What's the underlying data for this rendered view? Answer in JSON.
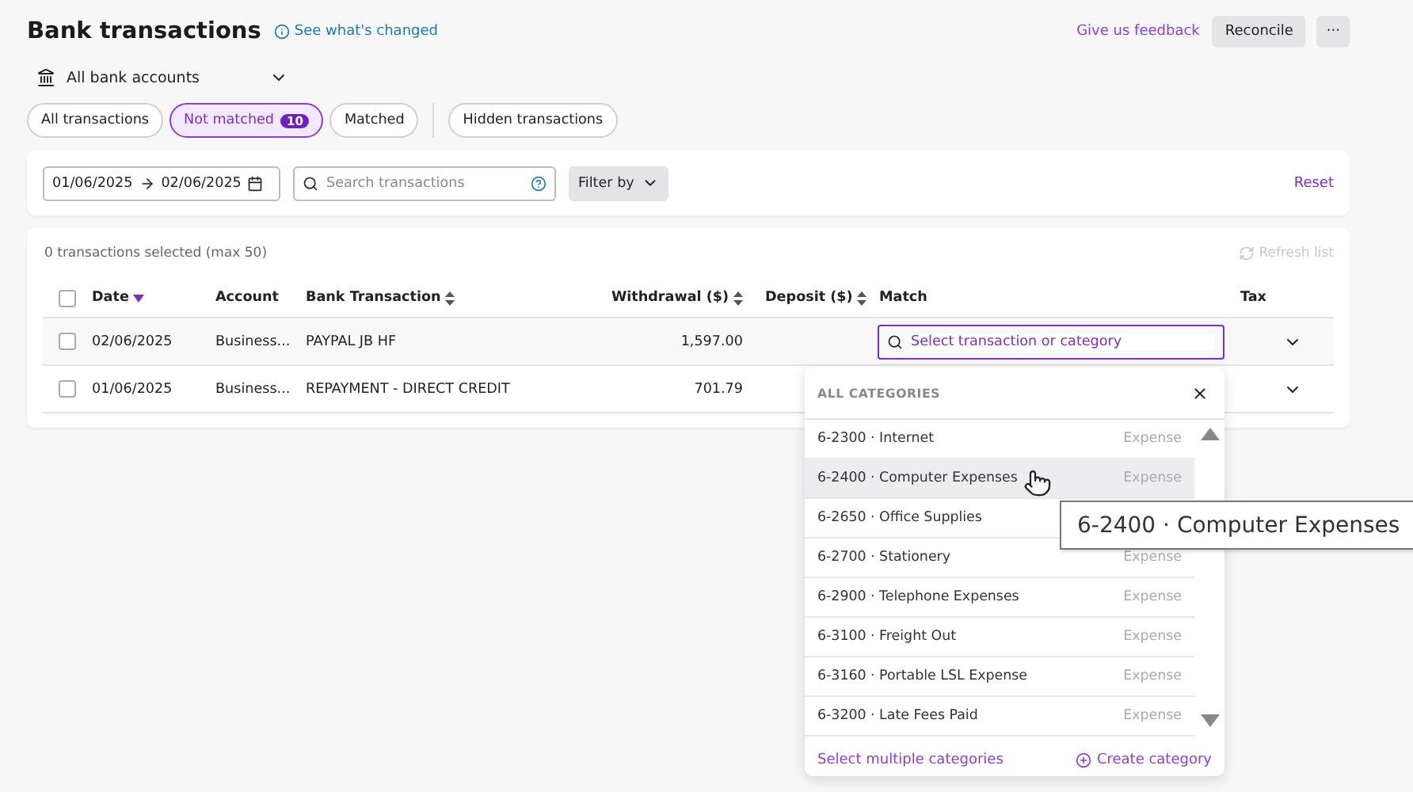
{
  "header": {
    "title": "Bank transactions",
    "whats_changed": "See what's changed",
    "feedback": "Give us feedback",
    "reconcile": "Reconcile",
    "more": "···"
  },
  "account_selector": {
    "value": "All bank accounts"
  },
  "tabs": [
    {
      "label": "All transactions",
      "selected": false
    },
    {
      "label": "Not matched",
      "selected": true,
      "count": "10"
    },
    {
      "label": "Matched",
      "selected": false
    },
    {
      "label": "Hidden transactions",
      "selected": false
    }
  ],
  "filters": {
    "date_from": "01/06/2025",
    "date_to": "02/06/2025",
    "search": {
      "placeholder": "Search transactions"
    },
    "filter_by": "Filter by",
    "reset": "Reset"
  },
  "table": {
    "selection_note": "0 transactions selected (max 50)",
    "refresh": "Refresh list",
    "select_all_checked": false,
    "columns": [
      {
        "label": "Date",
        "sortable": true,
        "sorted": true
      },
      {
        "label": "Account",
        "sortable": false,
        "sorted": false
      },
      {
        "label": "Bank Transaction",
        "sortable": true,
        "sorted": false
      },
      {
        "label": "Withdrawal ($)",
        "sortable": true,
        "sorted": false
      },
      {
        "label": "Deposit ($)",
        "sortable": true,
        "sorted": false
      },
      {
        "label": "Match",
        "sortable": false,
        "sorted": false
      },
      {
        "label": "Tax",
        "sortable": false,
        "sorted": false
      }
    ],
    "rows": [
      {
        "checked": false,
        "date": "02/06/2025",
        "account": "Business...",
        "transaction": "PAYPAL JB HF",
        "withdrawal": "1,597.00",
        "match_placeholder": "Select transaction or category"
      },
      {
        "checked": false,
        "date": "01/06/2025",
        "account": "Business...",
        "transaction": "REPAYMENT - DIRECT CREDIT",
        "withdrawal": "701.79"
      }
    ]
  },
  "category_dropdown": {
    "heading": "ALL CATEGORIES",
    "items": [
      {
        "label": "6-2300 · Internet",
        "type": "Expense",
        "hovered": false
      },
      {
        "label": "6-2400 · Computer Expenses",
        "type": "Expense",
        "hovered": true
      },
      {
        "label": "6-2650 · Office Supplies",
        "hovered": false
      },
      {
        "label": "6-2700 · Stationery",
        "type": "Expense",
        "hovered": false
      },
      {
        "label": "6-2900 · Telephone Expenses",
        "type": "Expense",
        "hovered": false
      },
      {
        "label": "6-3100 · Freight Out",
        "type": "Expense",
        "hovered": false
      },
      {
        "label": "6-3160 · Portable LSL Expense",
        "type": "Expense",
        "hovered": false
      },
      {
        "label": "6-3200 · Late Fees Paid",
        "type": "Expense",
        "hovered": false
      }
    ],
    "select_multiple": "Select multiple categories",
    "create": "Create category"
  },
  "tooltip": {
    "text": "6-2400 · Computer Expenses"
  }
}
